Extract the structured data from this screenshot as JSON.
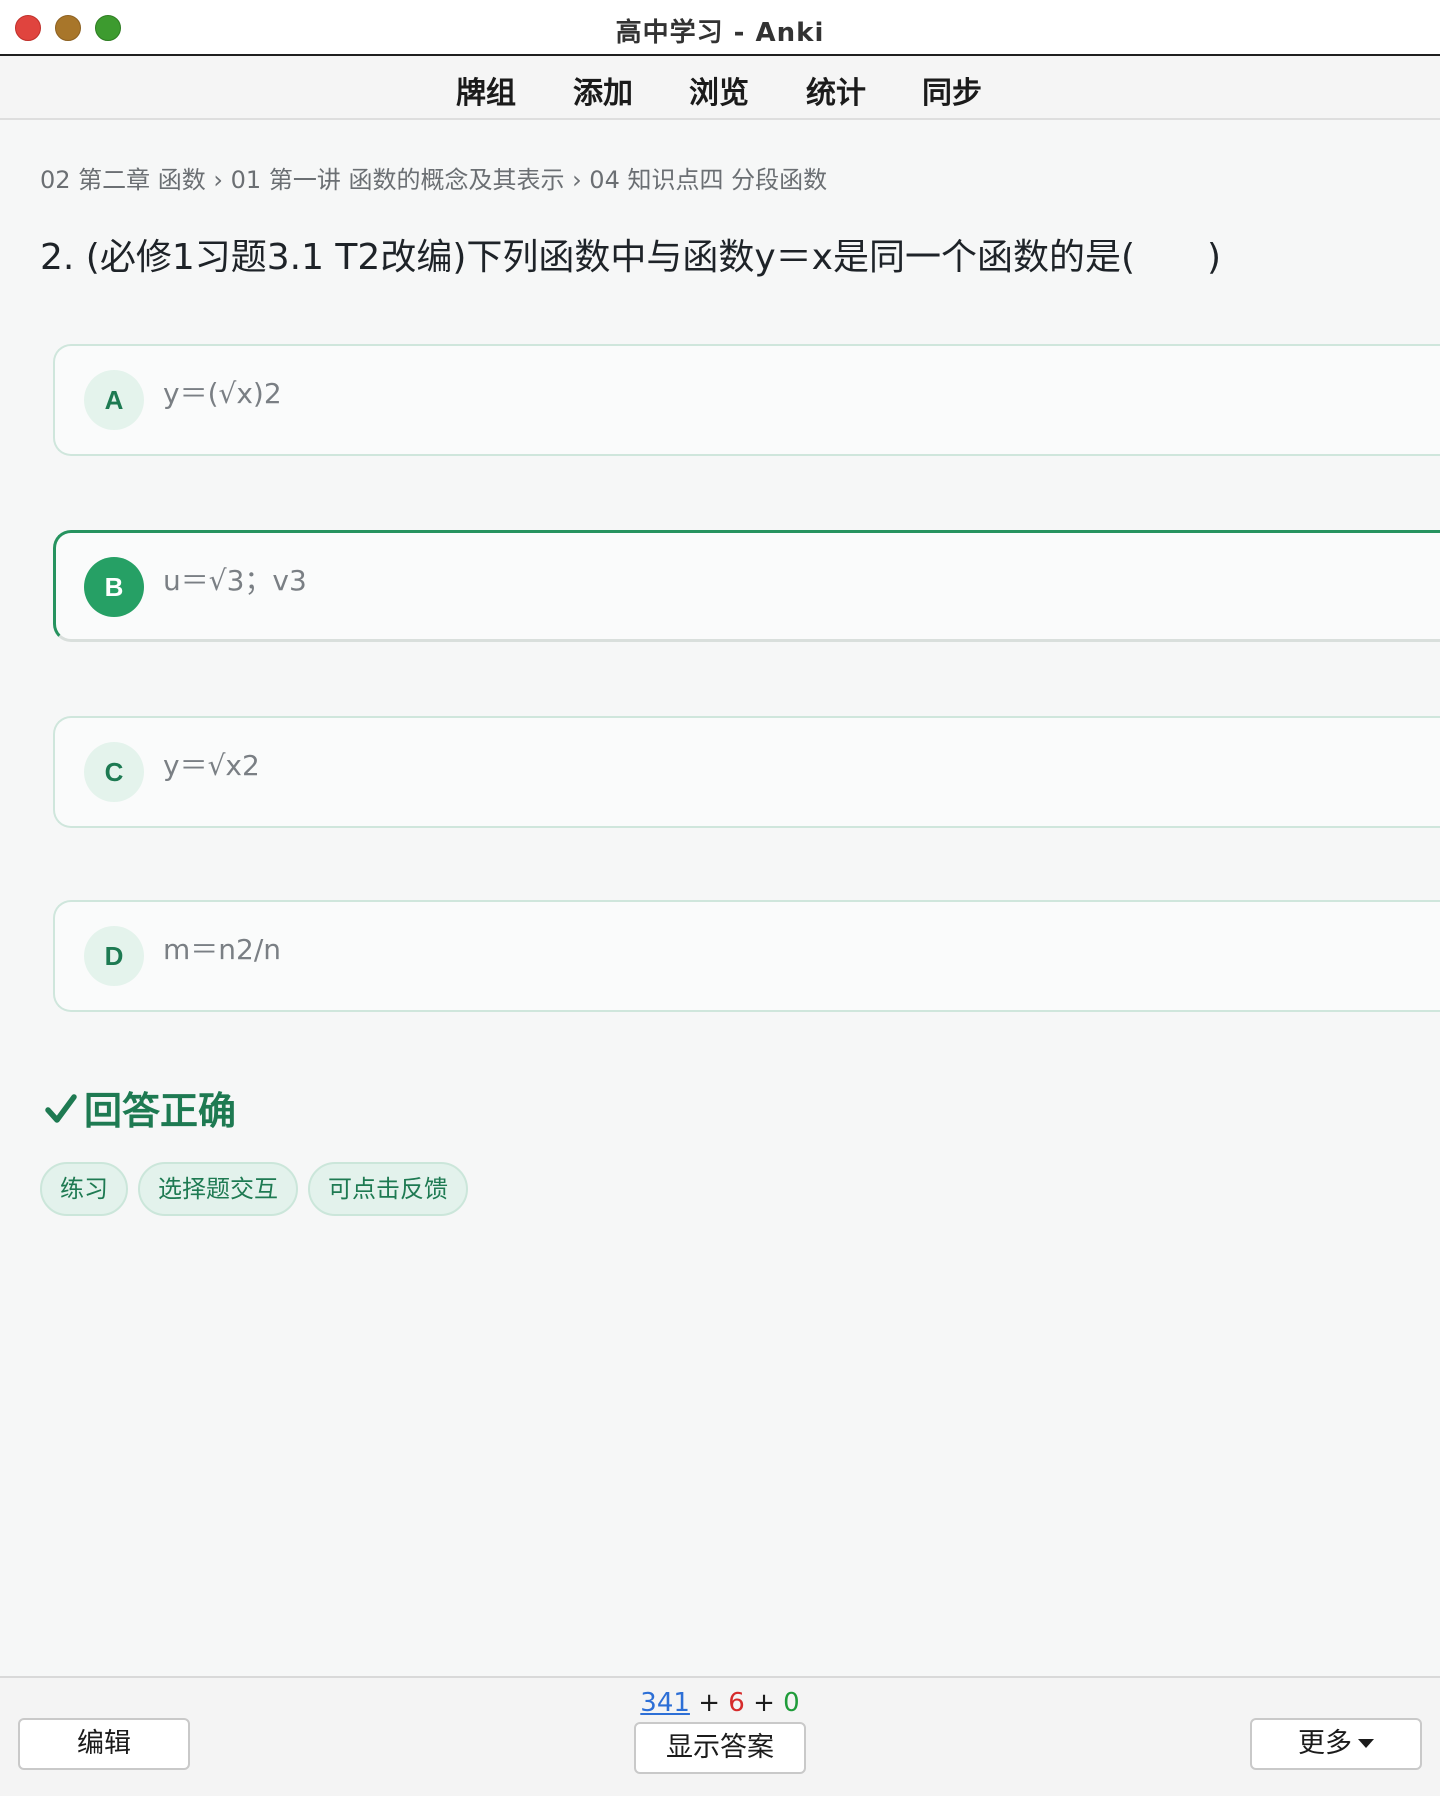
{
  "window": {
    "title": "高中学习 - Anki"
  },
  "nav": {
    "items": [
      "牌组",
      "添加",
      "浏览",
      "统计",
      "同步"
    ]
  },
  "card": {
    "breadcrumb": "02 第二章 函数 › 01 第一讲 函数的概念及其表示 › 04 知识点四 分段函数",
    "question": "2.  (必修1习题3.1 T2改编)下列函数中与函数y＝x是同一个函数的是(　　)",
    "options": [
      {
        "letter": "A",
        "text": "y＝(√x)2",
        "selected": false
      },
      {
        "letter": "B",
        "text": "u＝√3；v3",
        "selected": true
      },
      {
        "letter": "C",
        "text": "y＝√x2",
        "selected": false
      },
      {
        "letter": "D",
        "text": "m＝n2/n",
        "selected": false
      }
    ],
    "result": "回答正确",
    "tags": [
      "练习",
      "选择题交互",
      "可点击反馈"
    ]
  },
  "bottom": {
    "edit_label": "编辑",
    "show_answer_label": "显示答案",
    "more_label": "更多",
    "counts": {
      "new": "341",
      "learning": "6",
      "review": "0",
      "plus": "+"
    }
  },
  "colors": {
    "accent": "#26935f",
    "new": "#2d6fd6",
    "learning": "#d62b2b",
    "review": "#1f9c3a"
  },
  "icons": {
    "result": "check-icon",
    "more": "caret-down-icon"
  }
}
